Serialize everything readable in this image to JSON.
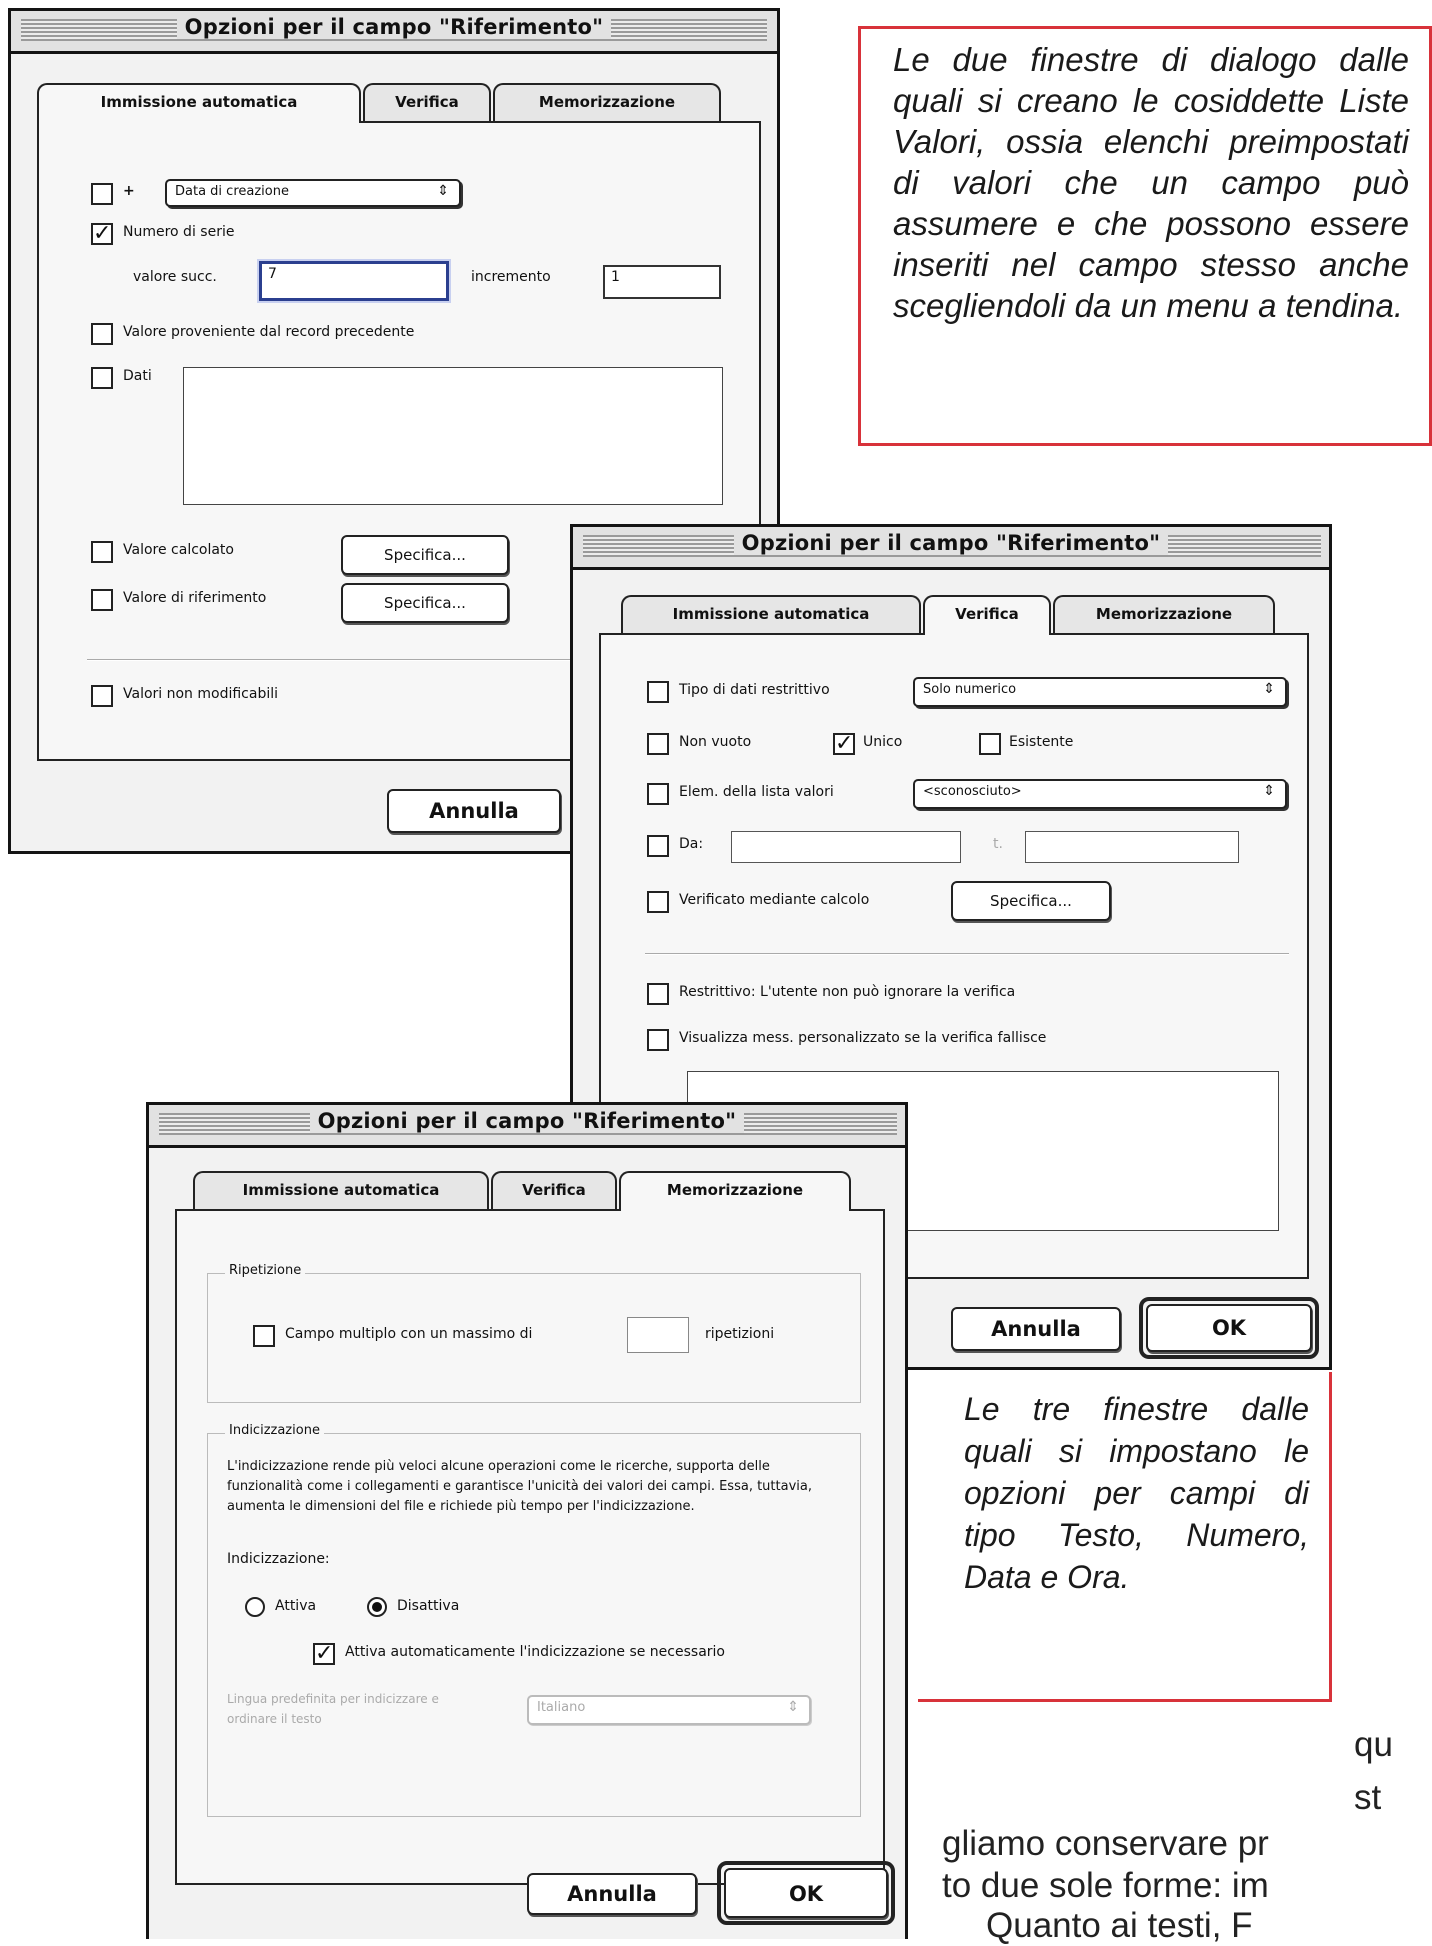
{
  "caption_top": "Le due finestre di dialogo dalle quali si creano le cosiddette Liste Valori, ossia elenchi preimpostati di valori che un campo può assumere e che possono essere inseriti nel campo stesso anche scegliendoli da un menu a tendina.",
  "caption_bottom": "Le tre finestre dalle quali si impostano le opzioni per campi di tipo Testo, Numero, Data e Ora.",
  "body_fragments": [
    "qu",
    "st",
    "gliamo conservare pr",
    "to due sole forme: im",
    "Quanto ai testi, F"
  ],
  "window_title": "Opzioni per il campo \"Riferimento\"",
  "tabs": [
    "Immissione automatica",
    "Verifica",
    "Memorizzazione"
  ],
  "auto_entry": {
    "creation_plus": "+",
    "creation_popup": "Data di creazione",
    "serial_number": "Numero di serie",
    "next_value_label": "valore succ.",
    "next_value": "7",
    "increment_label": "incremento",
    "increment_value": "1",
    "previous_record": "Valore proveniente dal record precedente",
    "data": "Dati",
    "calculated": "Valore calcolato",
    "lookup": "Valore di riferimento",
    "specify": "Specifica...",
    "prohibit_mod": "Valori non modificabili",
    "cancel": "Annulla"
  },
  "validation": {
    "strict_type": "Tipo di dati restrittivo",
    "strict_type_popup": "Solo numerico",
    "not_empty": "Non vuoto",
    "unique": "Unico",
    "existing": "Esistente",
    "member_of": "Elem. della lista valori",
    "member_popup": "<sconosciuto>",
    "from": "Da:",
    "to": "t.",
    "by_calc": "Verificato mediante calcolo",
    "specify": "Specifica...",
    "strict": "Restrittivo: L'utente non può ignorare la verifica",
    "custom_msg": "Visualizza mess. personalizzato se la verifica fallisce",
    "cancel": "Annulla",
    "ok": "OK"
  },
  "storage": {
    "repetition_title": "Ripetizione",
    "repeating": "Campo multiplo con un massimo di",
    "repetitions": "ripetizioni",
    "indexing_title": "Indicizzazione",
    "indexing_text": "L'indicizzazione rende più veloci alcune operazioni come le ricerche, supporta delle funzionalità come i collegamenti e garantisce l'unicità dei valori dei campi. Essa, tuttavia, aumenta le dimensioni del file e richiede più tempo per l'indicizzazione.",
    "indexing_label": "Indicizzazione:",
    "on": "Attiva",
    "off": "Disattiva",
    "auto_index": "Attiva automaticamente l'indicizzazione se necessario",
    "lang_label": "Lingua predefinita per indicizzare e ordinare il testo",
    "lang_popup": "Italiano",
    "cancel": "Annulla",
    "ok": "OK"
  }
}
